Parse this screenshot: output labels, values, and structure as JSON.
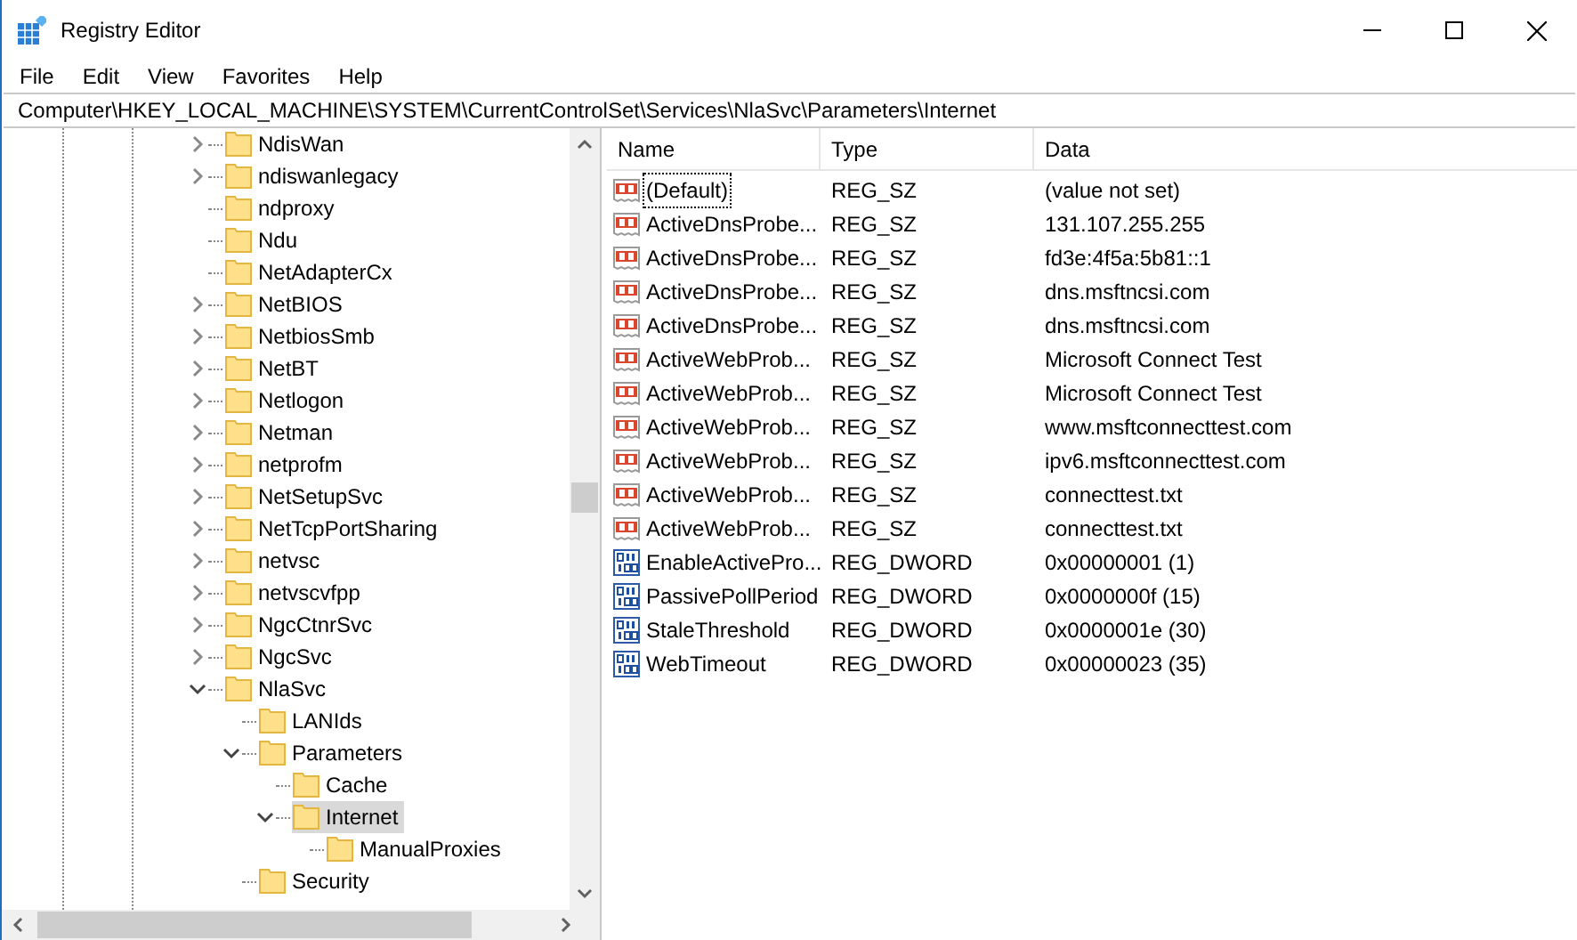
{
  "window": {
    "title": "Registry Editor"
  },
  "menu": [
    "File",
    "Edit",
    "View",
    "Favorites",
    "Help"
  ],
  "address": "Computer\\HKEY_LOCAL_MACHINE\\SYSTEM\\CurrentControlSet\\Services\\NlaSvc\\Parameters\\Internet",
  "tree": [
    {
      "label": "NdisWan",
      "expanded": false,
      "selected": false
    },
    {
      "label": "ndiswanlegacy",
      "expanded": false,
      "selected": false
    },
    {
      "label": "ndproxy",
      "selected": false
    },
    {
      "label": "Ndu",
      "selected": false
    },
    {
      "label": "NetAdapterCx",
      "selected": false
    },
    {
      "label": "NetBIOS",
      "expanded": false,
      "selected": false
    },
    {
      "label": "NetbiosSmb",
      "expanded": false,
      "selected": false
    },
    {
      "label": "NetBT",
      "expanded": false,
      "selected": false
    },
    {
      "label": "Netlogon",
      "expanded": false,
      "selected": false
    },
    {
      "label": "Netman",
      "expanded": false,
      "selected": false
    },
    {
      "label": "netprofm",
      "expanded": false,
      "selected": false
    },
    {
      "label": "NetSetupSvc",
      "expanded": false,
      "selected": false
    },
    {
      "label": "NetTcpPortSharing",
      "expanded": false,
      "selected": false
    },
    {
      "label": "netvsc",
      "expanded": false,
      "selected": false
    },
    {
      "label": "netvscvfpp",
      "expanded": false,
      "selected": false
    },
    {
      "label": "NgcCtnrSvc",
      "expanded": false,
      "selected": false
    },
    {
      "label": "NgcSvc",
      "expanded": false,
      "selected": false
    },
    {
      "label": "NlaSvc",
      "expanded": true,
      "selected": false,
      "children": [
        {
          "label": "LANIds",
          "selected": false
        },
        {
          "label": "Parameters",
          "expanded": true,
          "selected": false,
          "children": [
            {
              "label": "Cache",
              "selected": false
            },
            {
              "label": "Internet",
              "expanded": true,
              "selected": true,
              "children": [
                {
                  "label": "ManualProxies",
                  "selected": false
                }
              ]
            }
          ]
        },
        {
          "label": "Security",
          "selected": false
        }
      ]
    }
  ],
  "values": {
    "columns": [
      "Name",
      "Type",
      "Data"
    ],
    "rows": [
      {
        "kind": "string",
        "name": "(Default)",
        "type": "REG_SZ",
        "data": "(value not set)",
        "focused": true
      },
      {
        "kind": "string",
        "name": "ActiveDnsProbe...",
        "type": "REG_SZ",
        "data": "131.107.255.255",
        "focused": false
      },
      {
        "kind": "string",
        "name": "ActiveDnsProbe...",
        "type": "REG_SZ",
        "data": "fd3e:4f5a:5b81::1",
        "focused": false
      },
      {
        "kind": "string",
        "name": "ActiveDnsProbe...",
        "type": "REG_SZ",
        "data": "dns.msftncsi.com",
        "focused": false
      },
      {
        "kind": "string",
        "name": "ActiveDnsProbe...",
        "type": "REG_SZ",
        "data": "dns.msftncsi.com",
        "focused": false
      },
      {
        "kind": "string",
        "name": "ActiveWebProb...",
        "type": "REG_SZ",
        "data": "Microsoft Connect Test",
        "focused": false
      },
      {
        "kind": "string",
        "name": "ActiveWebProb...",
        "type": "REG_SZ",
        "data": "Microsoft Connect Test",
        "focused": false
      },
      {
        "kind": "string",
        "name": "ActiveWebProb...",
        "type": "REG_SZ",
        "data": "www.msftconnecttest.com",
        "focused": false
      },
      {
        "kind": "string",
        "name": "ActiveWebProb...",
        "type": "REG_SZ",
        "data": "ipv6.msftconnecttest.com",
        "focused": false
      },
      {
        "kind": "string",
        "name": "ActiveWebProb...",
        "type": "REG_SZ",
        "data": "connecttest.txt",
        "focused": false
      },
      {
        "kind": "string",
        "name": "ActiveWebProb...",
        "type": "REG_SZ",
        "data": "connecttest.txt",
        "focused": false
      },
      {
        "kind": "dword",
        "name": "EnableActivePro...",
        "type": "REG_DWORD",
        "data": "0x00000001 (1)",
        "focused": false
      },
      {
        "kind": "dword",
        "name": "PassivePollPeriod",
        "type": "REG_DWORD",
        "data": "0x0000000f (15)",
        "focused": false
      },
      {
        "kind": "dword",
        "name": "StaleThreshold",
        "type": "REG_DWORD",
        "data": "0x0000001e (30)",
        "focused": false
      },
      {
        "kind": "dword",
        "name": "WebTimeout",
        "type": "REG_DWORD",
        "data": "0x00000023 (35)",
        "focused": false
      }
    ]
  }
}
